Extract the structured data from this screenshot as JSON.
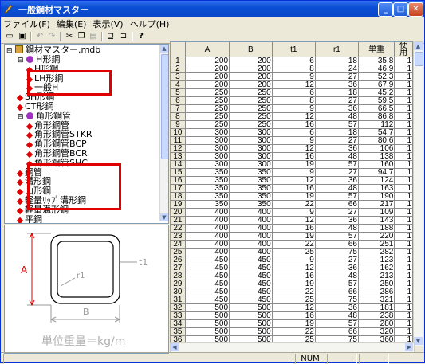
{
  "window": {
    "title": "一般鋼材マスター"
  },
  "menu": [
    "ファイル(F)",
    "編集(E)",
    "表示(V)",
    "ヘルプ(H)"
  ],
  "toolbar": {
    "icons": [
      "new-icon",
      "save-icon",
      "undo-icon",
      "redo-icon",
      "cut-icon",
      "copy-icon",
      "paste-icon",
      "insert-row-icon",
      "delete-row-icon",
      "help-icon"
    ]
  },
  "tree": {
    "root": "鋼材マスター.mdb",
    "items": [
      {
        "label": "H形鋼",
        "level": 1,
        "expander": "⊟"
      },
      {
        "label": "H形鋼",
        "level": 2
      },
      {
        "label": "LH形鋼",
        "level": 2
      },
      {
        "label": "一般H",
        "level": 2
      },
      {
        "label": "SH形鋼",
        "level": 1
      },
      {
        "label": "CT形鋼",
        "level": 1
      },
      {
        "label": "角形鋼管",
        "level": 1,
        "expander": "⊟"
      },
      {
        "label": "角形鋼管",
        "level": 2
      },
      {
        "label": "角形鋼管STKR",
        "level": 2
      },
      {
        "label": "角形鋼管BCP",
        "level": 2
      },
      {
        "label": "角形鋼管BCR",
        "level": 2
      },
      {
        "label": "角形鋼管SHC",
        "level": 2
      },
      {
        "label": "鋼管",
        "level": 1
      },
      {
        "label": "溝形鋼",
        "level": 1
      },
      {
        "label": "山形鋼",
        "level": 1
      },
      {
        "label": "軽量ﾘｯﾌﾟ溝形鋼",
        "level": 1
      },
      {
        "label": "軽量溝形鋼",
        "level": 1
      },
      {
        "label": "平鋼",
        "level": 1
      },
      {
        "label": "P L",
        "level": 1
      }
    ]
  },
  "diagram": {
    "label_a": "A",
    "label_b": "B",
    "label_t1": "t1",
    "label_r1": "r1",
    "unit_weight": "単位重量＝kg/m"
  },
  "grid": {
    "columns": [
      "A",
      "B",
      "t1",
      "r1",
      "単重",
      "使用"
    ],
    "rows": [
      [
        "1",
        "200",
        "200",
        "6",
        "18",
        "35.8",
        "1"
      ],
      [
        "2",
        "200",
        "200",
        "8",
        "24",
        "46.9",
        "1"
      ],
      [
        "3",
        "200",
        "200",
        "9",
        "27",
        "52.3",
        "1"
      ],
      [
        "4",
        "200",
        "200",
        "12",
        "36",
        "67.9",
        "1"
      ],
      [
        "5",
        "250",
        "250",
        "6",
        "18",
        "45.2",
        "1"
      ],
      [
        "6",
        "250",
        "250",
        "8",
        "27",
        "59.5",
        "1"
      ],
      [
        "7",
        "250",
        "250",
        "9",
        "36",
        "66.5",
        "1"
      ],
      [
        "8",
        "250",
        "250",
        "12",
        "48",
        "86.8",
        "1"
      ],
      [
        "9",
        "250",
        "250",
        "16",
        "57",
        "112",
        "1"
      ],
      [
        "10",
        "300",
        "300",
        "6",
        "18",
        "54.7",
        "1"
      ],
      [
        "11",
        "300",
        "300",
        "9",
        "27",
        "80.6",
        "1"
      ],
      [
        "12",
        "300",
        "300",
        "12",
        "36",
        "106",
        "1"
      ],
      [
        "13",
        "300",
        "300",
        "16",
        "48",
        "138",
        "1"
      ],
      [
        "14",
        "300",
        "300",
        "19",
        "57",
        "160",
        "1"
      ],
      [
        "15",
        "350",
        "350",
        "9",
        "27",
        "94.7",
        "1"
      ],
      [
        "16",
        "350",
        "350",
        "12",
        "36",
        "124",
        "1"
      ],
      [
        "17",
        "350",
        "350",
        "16",
        "48",
        "163",
        "1"
      ],
      [
        "18",
        "350",
        "350",
        "19",
        "57",
        "190",
        "1"
      ],
      [
        "19",
        "350",
        "350",
        "22",
        "66",
        "217",
        "1"
      ],
      [
        "20",
        "400",
        "400",
        "9",
        "27",
        "109",
        "1"
      ],
      [
        "21",
        "400",
        "400",
        "12",
        "36",
        "143",
        "1"
      ],
      [
        "22",
        "400",
        "400",
        "16",
        "48",
        "188",
        "1"
      ],
      [
        "23",
        "400",
        "400",
        "19",
        "57",
        "220",
        "1"
      ],
      [
        "24",
        "400",
        "400",
        "22",
        "66",
        "251",
        "1"
      ],
      [
        "25",
        "400",
        "400",
        "25",
        "75",
        "282",
        "1"
      ],
      [
        "26",
        "450",
        "450",
        "9",
        "27",
        "123",
        "1"
      ],
      [
        "27",
        "450",
        "450",
        "12",
        "36",
        "162",
        "1"
      ],
      [
        "28",
        "450",
        "450",
        "16",
        "48",
        "213",
        "1"
      ],
      [
        "29",
        "450",
        "450",
        "19",
        "57",
        "250",
        "1"
      ],
      [
        "30",
        "450",
        "450",
        "22",
        "66",
        "286",
        "1"
      ],
      [
        "31",
        "450",
        "450",
        "25",
        "75",
        "321",
        "1"
      ],
      [
        "32",
        "500",
        "500",
        "12",
        "36",
        "181",
        "1"
      ],
      [
        "33",
        "500",
        "500",
        "16",
        "48",
        "238",
        "1"
      ],
      [
        "34",
        "500",
        "500",
        "19",
        "57",
        "280",
        "1"
      ],
      [
        "35",
        "500",
        "500",
        "22",
        "66",
        "320",
        "1"
      ],
      [
        "36",
        "500",
        "500",
        "25",
        "75",
        "360",
        "1"
      ]
    ]
  },
  "status": {
    "num": "NUM"
  }
}
